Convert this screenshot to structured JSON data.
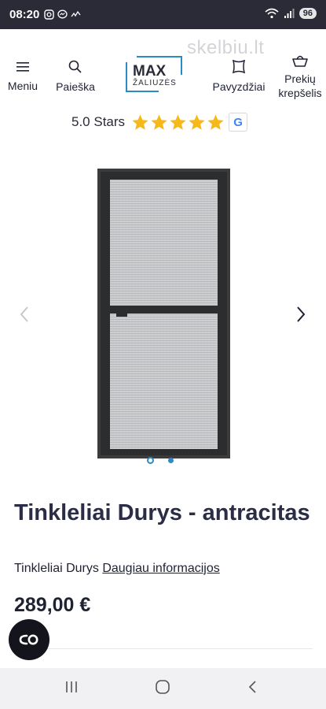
{
  "status_bar": {
    "time": "08:20",
    "battery": "96",
    "status_icons": [
      "instagram-icon",
      "messenger-icon",
      "signal-wave-icon"
    ],
    "system_icons": [
      "wifi-icon",
      "cell-signal-icon"
    ]
  },
  "header": {
    "watermark": "skelbiu.lt",
    "menu_label": "Meniu",
    "search_label": "Paieška",
    "logo": {
      "line1": "MAX",
      "line2": "ŽALIUZĖS",
      "accent_color": "#2b8cc4"
    },
    "samples_label": "Pavyzdžiai",
    "cart_label_line1": "Prekių",
    "cart_label_line2": "krepšelis"
  },
  "rating": {
    "text": "5.0 Stars",
    "stars": 5,
    "star_color": "#f6b81a",
    "badge": "G"
  },
  "gallery": {
    "image_count": 2,
    "active_index": 0,
    "frame_color": "#3a3b3d"
  },
  "product": {
    "title": "Tinkleliai Durys - antracitas",
    "subtitle": "Tinkleliai Durys",
    "more_info_link": "Daugiau informacijos",
    "price": "289,00 €"
  },
  "system_nav": {
    "recent": "recents-icon",
    "home": "home-icon",
    "back": "back-icon"
  }
}
